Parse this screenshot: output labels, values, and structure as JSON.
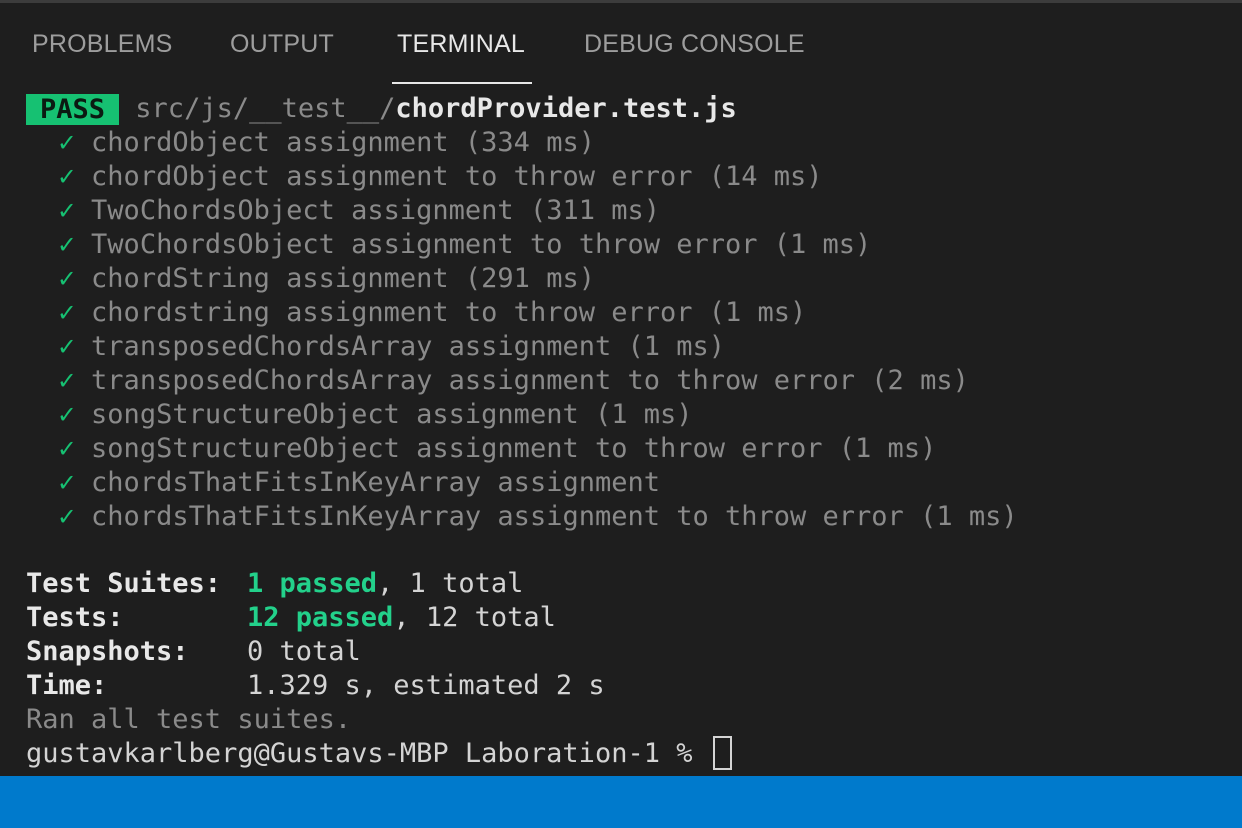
{
  "tabs": [
    {
      "label": "PROBLEMS",
      "active": false
    },
    {
      "label": "OUTPUT",
      "active": false
    },
    {
      "label": "TERMINAL",
      "active": true
    },
    {
      "label": "DEBUG CONSOLE",
      "active": false
    }
  ],
  "terminal": {
    "pass_badge": "PASS",
    "file_dir": "src/js/__test__/",
    "file_name": "chordProvider.test.js",
    "check_mark": "✓",
    "tests": [
      "chordObject assignment (334 ms)",
      "chordObject assignment to throw error (14 ms)",
      "TwoChordsObject assignment (311 ms)",
      "TwoChordsObject assignment to throw error (1 ms)",
      "chordString assignment (291 ms)",
      "chordstring assignment to throw error (1 ms)",
      "transposedChordsArray assignment (1 ms)",
      "transposedChordsArray assignment to throw error (2 ms)",
      "songStructureObject assignment (1 ms)",
      "songStructureObject assignment to throw error (1 ms)",
      "chordsThatFitsInKeyArray assignment",
      "chordsThatFitsInKeyArray assignment to throw error (1 ms)"
    ],
    "summary": {
      "suites_label": "Test Suites:",
      "suites_passed": "1 passed",
      "suites_total": ", 1 total",
      "tests_label": "Tests:",
      "tests_passed": "12 passed",
      "tests_total": ", 12 total",
      "snapshots_label": "Snapshots:",
      "snapshots_value": "0 total",
      "time_label": "Time:",
      "time_value": "1.329 s, estimated 2 s"
    },
    "ran_all": "Ran all test suites.",
    "prompt": "gustavkarlberg@Gustavs-MBP Laboration-1 % "
  },
  "colors": {
    "background": "#1e1e1e",
    "pass_green": "#16c172",
    "status_bar": "#007acc"
  }
}
